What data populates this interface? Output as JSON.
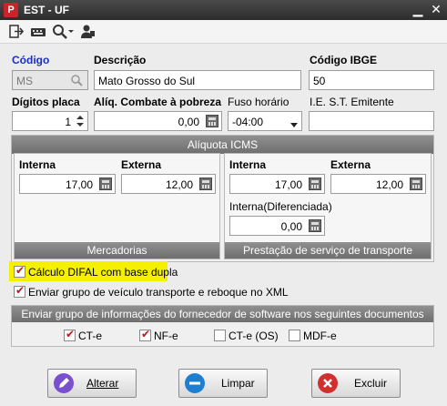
{
  "window": {
    "title": "EST - UF",
    "logo_letter": "P",
    "minimize": "▁",
    "close": "✕"
  },
  "form": {
    "codigo": {
      "label": "Código",
      "value": "MS"
    },
    "descricao": {
      "label": "Descrição",
      "value": "Mato Grosso do Sul"
    },
    "codigo_ibge": {
      "label": "Código IBGE",
      "value": "50"
    },
    "digitos_placa": {
      "label": "Dígitos placa",
      "value": "1"
    },
    "aliq_pobreza": {
      "label": "Alíq. Combate à pobreza",
      "value": "0,00"
    },
    "fuso_horario": {
      "label": "Fuso horário",
      "value": "-04:00"
    },
    "ie_st": {
      "label": "I.E. S.T. Emitente",
      "value": ""
    }
  },
  "aliquota_icms": {
    "title": "Alíquota ICMS",
    "mercadorias": {
      "footer": "Mercadorias",
      "interna_label": "Interna",
      "interna_value": "17,00",
      "externa_label": "Externa",
      "externa_value": "12,00"
    },
    "transporte": {
      "footer": "Prestação de serviço de transporte",
      "interna_label": "Interna",
      "interna_value": "17,00",
      "externa_label": "Externa",
      "externa_value": "12,00",
      "diferenciada_label": "Interna(Diferenciada)",
      "diferenciada_value": "0,00"
    }
  },
  "options": {
    "difal": {
      "label": "Cálculo DIFAL com base dupla",
      "checked": true
    },
    "veiculo": {
      "label": "Enviar grupo de veículo transporte e reboque no XML",
      "checked": true
    }
  },
  "software_group": {
    "title": "Enviar grupo de informações do fornecedor de software nos seguintes documentos",
    "items": [
      {
        "label": "CT-e",
        "checked": true
      },
      {
        "label": "NF-e",
        "checked": true
      },
      {
        "label": "CT-e (OS)",
        "checked": false
      },
      {
        "label": "MDF-e",
        "checked": false
      }
    ]
  },
  "buttons": {
    "alterar": {
      "label": "Alterar",
      "color": "#7a4fd0"
    },
    "limpar": {
      "label": "Limpar",
      "color": "#1e7fd0"
    },
    "excluir": {
      "label": "Excluir",
      "color": "#d03030"
    }
  }
}
